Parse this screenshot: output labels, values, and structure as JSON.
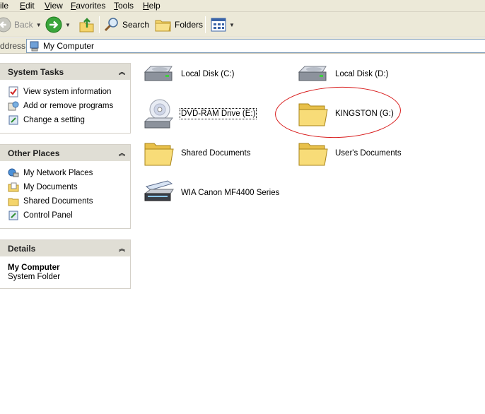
{
  "menu": [
    {
      "label": "File",
      "shown": "ile"
    },
    {
      "label": "Edit"
    },
    {
      "label": "View"
    },
    {
      "label": "Favorites"
    },
    {
      "label": "Tools"
    },
    {
      "label": "Help"
    }
  ],
  "toolbar": {
    "back_label": "Back",
    "search_label": "Search",
    "folders_label": "Folders"
  },
  "address": {
    "label": "ddress",
    "value": "My Computer"
  },
  "panels": {
    "system_tasks": {
      "title": "System Tasks",
      "links": [
        "View system information",
        "Add or remove programs",
        "Change a setting"
      ]
    },
    "other_places": {
      "title": "Other Places",
      "links": [
        "My Network Places",
        "My Documents",
        "Shared Documents",
        "Control Panel"
      ]
    },
    "details": {
      "title": "Details",
      "name": "My Computer",
      "type": "System Folder"
    }
  },
  "items": {
    "local_c": "Local Disk (C:)",
    "local_d": "Local Disk (D:)",
    "dvd_e": "DVD-RAM Drive (E:)",
    "kingston_g": "KINGSTON (G:)",
    "shared_docs": "Shared Documents",
    "users_docs": "User's Documents",
    "canon": "WIA Canon MF4400 Series"
  },
  "annotation_color": "#d81a1a"
}
